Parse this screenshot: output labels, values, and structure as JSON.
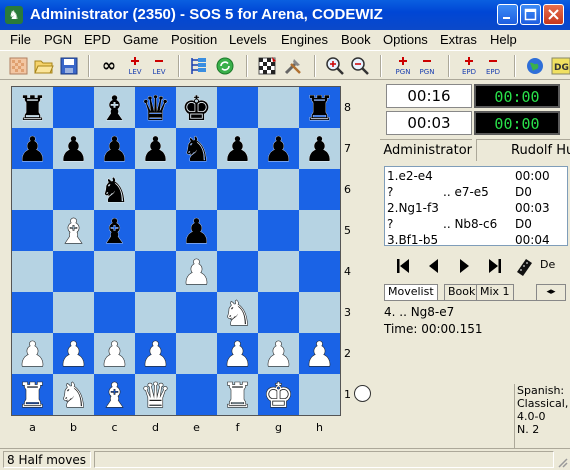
{
  "window": {
    "title": "Administrator (2350) - SOS 5 for Arena, CODEWIZ"
  },
  "menu": [
    "File",
    "PGN",
    "EPD",
    "Game",
    "Position",
    "Levels",
    "Engines",
    "Book",
    "Options",
    "Extras",
    "Help"
  ],
  "toolbar": {
    "icons": [
      "new-position-icon",
      "open-folder-icon",
      "save-disk-icon",
      "infinite-analysis-icon",
      "level-plus-icon",
      "level-minus-icon",
      "move-list-icon",
      "refresh-icon",
      "setup-board-icon",
      "tools-icon",
      "zoom-in-icon",
      "zoom-out-icon",
      "pgn-plus-icon",
      "pgn-minus-icon",
      "epd-plus-icon",
      "epd-minus-icon",
      "globe-icon"
    ],
    "lev_label": "LEV",
    "pgn_label": "PGN",
    "epd_label": "EPD",
    "dg_label": "DG"
  },
  "board": {
    "files": [
      "a",
      "b",
      "c",
      "d",
      "e",
      "f",
      "g",
      "h"
    ],
    "ranks": [
      "8",
      "7",
      "6",
      "5",
      "4",
      "3",
      "2",
      "1"
    ],
    "position": [
      [
        "bR",
        "",
        "bB",
        "bQ",
        "bK",
        "",
        "",
        "bR"
      ],
      [
        "bP",
        "bP",
        "bP",
        "bP",
        "bN",
        "bP",
        "bP",
        "bP"
      ],
      [
        "",
        "",
        "bN",
        "",
        "",
        "",
        "",
        ""
      ],
      [
        "",
        "wB",
        "bB",
        "",
        "bP",
        "",
        "",
        ""
      ],
      [
        "",
        "",
        "",
        "",
        "wP",
        "",
        "",
        ""
      ],
      [
        "",
        "",
        "",
        "",
        "",
        "wN",
        "",
        ""
      ],
      [
        "wP",
        "wP",
        "wP",
        "wP",
        "",
        "wP",
        "wP",
        "wP"
      ],
      [
        "wR",
        "wN",
        "wB",
        "wQ",
        "",
        "wR",
        "wK",
        ""
      ]
    ],
    "side_to_move": "white"
  },
  "clocks": {
    "white_time": "00:16",
    "white_move_time": "00:03",
    "black_time": "00:00",
    "black_move_time": "00:00"
  },
  "players": {
    "white": "Administrator",
    "black": "Rudolf Huber"
  },
  "movelist": [
    {
      "move": "1.e2-e4",
      "time": "00:00"
    },
    {
      "move": "?",
      "reply": ".. e7-e5",
      "depth": "D0"
    },
    {
      "move": "2.Ng1-f3",
      "time": "00:03"
    },
    {
      "move": "?",
      "reply": ".. Nb8-c6",
      "depth": "D0"
    },
    {
      "move": "3.Bf1-b5",
      "time": "00:04"
    }
  ],
  "tabs": [
    "Movelist",
    "Book",
    "Mix 1"
  ],
  "info": {
    "last_move": "4. .. Ng8-e7",
    "time": "Time: 00:00.151"
  },
  "opening": [
    "Spanish:",
    "Classical,",
    "4.0-0",
    "N. 2"
  ],
  "status": {
    "half_moves": "8 Half moves"
  },
  "colors": {
    "light_square": "#b6d3e3",
    "dark_square": "#1a63e6",
    "clock_green": "#29e04a"
  }
}
